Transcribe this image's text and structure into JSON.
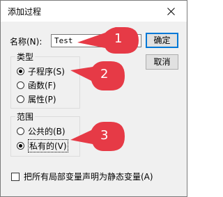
{
  "window": {
    "title": "添加过程"
  },
  "name_field": {
    "label": "名称(N):",
    "value": "Test"
  },
  "buttons": {
    "ok": "确定",
    "cancel": "取消"
  },
  "type_group": {
    "title": "类型",
    "options": [
      "子程序(S)",
      "函数(F)",
      "属性(P)"
    ],
    "selected": "子程序(S)"
  },
  "scope_group": {
    "title": "范围",
    "options": [
      "公共的(B)",
      "私有的(V)"
    ],
    "selected": "私有的(V)"
  },
  "static_checkbox": {
    "label": "把所有局部变量声明为静态变量(A)",
    "checked": false
  },
  "callouts": [
    "1",
    "2",
    "3"
  ],
  "colors": {
    "callout_fill": "#e63a46",
    "accent": "#0078d7"
  }
}
